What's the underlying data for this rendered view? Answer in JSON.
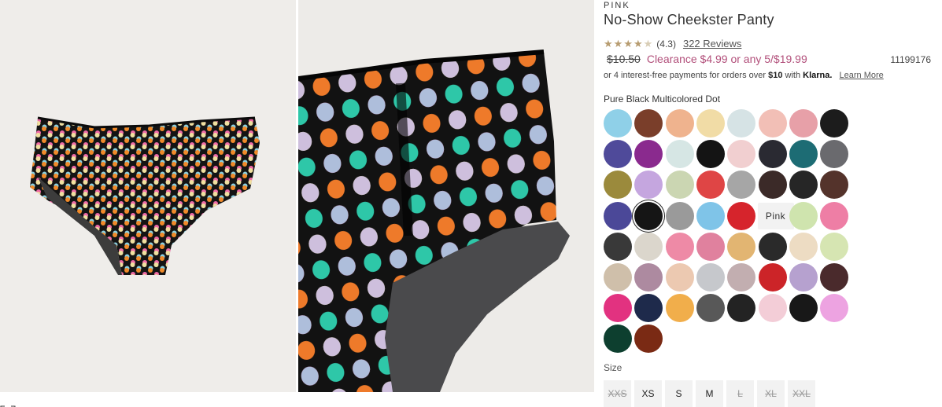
{
  "product": {
    "brand": "PINK",
    "title": "No-Show Cheekster Panty",
    "rating_value": 4.3,
    "rating_text": "(4.3)",
    "reviews": "322 Reviews",
    "old_price": "$10.50",
    "sale_price": "Clearance $4.99 or any 5/$19.99",
    "sku": "11199176",
    "klarna_prefix": "or 4 interest-free payments for orders over",
    "klarna_amount": "$10",
    "klarna_with": "with",
    "klarna_brand": "Klarna.",
    "klarna_learn": "Learn More",
    "selected_color": "Pure Black Multicolored Dot"
  },
  "swatches": [
    {
      "color": "#8fd0e8"
    },
    {
      "color": "#7a3e2a"
    },
    {
      "color": "#efb38e"
    },
    {
      "color": "#f1dca6"
    },
    {
      "color": "#d6e3e5"
    },
    {
      "color": "#f2bfb6"
    },
    {
      "color": "#e7a0a8"
    },
    {
      "color": "#1c1c1c"
    },
    {
      "color": "#4f4a9a"
    },
    {
      "color": "#8a2a8e"
    },
    {
      "color": "#d6e6e4"
    },
    {
      "color": "#141414"
    },
    {
      "color": "#f1cfd0"
    },
    {
      "color": "#2a2a32"
    },
    {
      "color": "#1d6c74"
    },
    {
      "color": "#6a6a6e"
    },
    {
      "color": "#9b8a3c"
    },
    {
      "color": "#c5a6df"
    },
    {
      "color": "#cbd6b2"
    },
    {
      "color": "#df4545"
    },
    {
      "color": "#a6a6a6"
    },
    {
      "color": "#3b2a28"
    },
    {
      "color": "#262626"
    },
    {
      "color": "#54332b"
    },
    {
      "color": "#4b4898"
    },
    {
      "color": "#151515",
      "selected": true
    },
    {
      "color": "#9a9a9a"
    },
    {
      "color": "#7fc4e8"
    },
    {
      "color": "#d6242c"
    },
    {
      "label": "Pink"
    },
    {
      "color": "#cfe4ae"
    },
    {
      "color": "#ee7ea5"
    },
    {
      "color": "#393939"
    },
    {
      "color": "#dbd6cc"
    },
    {
      "color": "#ee8aa6"
    },
    {
      "color": "#e0819e"
    },
    {
      "color": "#e2b572"
    },
    {
      "color": "#2a2a2a"
    },
    {
      "color": "#eddcc3"
    },
    {
      "color": "#d6e5b2"
    },
    {
      "color": "#cfbfaa"
    },
    {
      "color": "#ad8aa0"
    },
    {
      "color": "#ecc9b1"
    },
    {
      "color": "#c6c8cc"
    },
    {
      "color": "#c2aeb0"
    },
    {
      "color": "#cc2428"
    },
    {
      "color": "#b6a1cf"
    },
    {
      "color": "#4a2a2c"
    },
    {
      "color": "#e23280"
    },
    {
      "color": "#1e2a4b"
    },
    {
      "color": "#f1ae4b"
    },
    {
      "color": "#585858"
    },
    {
      "color": "#232323"
    },
    {
      "color": "#f3cdd7"
    },
    {
      "color": "#181818"
    },
    {
      "color": "#eda3e1"
    },
    {
      "color": "#0d3f2f"
    },
    {
      "color": "#7a2a14"
    }
  ],
  "size_label": "Size",
  "sizes": [
    {
      "label": "XXS",
      "available": false
    },
    {
      "label": "XS",
      "available": true
    },
    {
      "label": "S",
      "available": true
    },
    {
      "label": "M",
      "available": true
    },
    {
      "label": "L",
      "available": false
    },
    {
      "label": "XL",
      "available": false
    },
    {
      "label": "XXL",
      "available": false
    }
  ]
}
